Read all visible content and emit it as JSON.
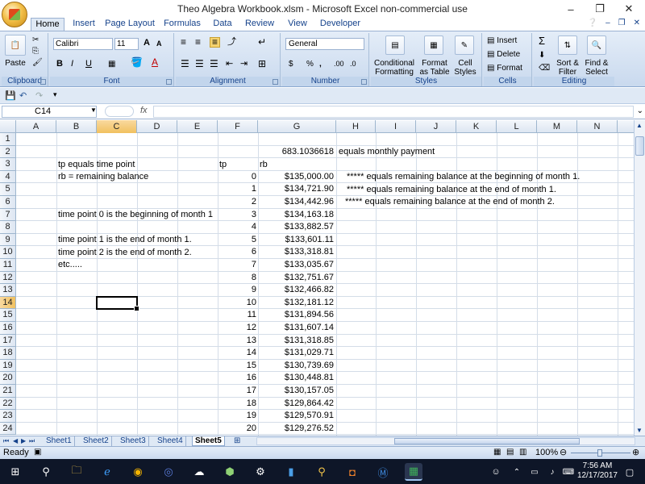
{
  "window": {
    "title": "Theo Algebra Workbook.xlsm - Microsoft Excel non-commercial use",
    "minimize": "–",
    "restore": "❐",
    "close": "✕"
  },
  "ribbon_tabs": [
    "Home",
    "Insert",
    "Page Layout",
    "Formulas",
    "Data",
    "Review",
    "View",
    "Developer"
  ],
  "active_tab": "Home",
  "ribbon": {
    "clipboard": {
      "label": "Clipboard",
      "paste": "Paste"
    },
    "font": {
      "label": "Font",
      "name": "Calibri",
      "size": "11",
      "bold": "B",
      "italic": "I",
      "underline": "U",
      "grow": "A",
      "shrink": "A"
    },
    "alignment": {
      "label": "Alignment"
    },
    "number": {
      "label": "Number",
      "format": "General",
      "currency": "$",
      "percent": "%",
      "comma": ",",
      "inc_dec": ".00",
      "dec_dec": ".0"
    },
    "styles": {
      "label": "Styles",
      "conditional": "Conditional",
      "conditional2": "Formatting",
      "format_table": "Format",
      "format_table2": "as Table",
      "cell_styles": "Cell",
      "cell_styles2": "Styles"
    },
    "cells": {
      "label": "Cells",
      "insert": "Insert",
      "delete": "Delete",
      "format": "Format"
    },
    "editing": {
      "label": "Editing",
      "sum": "Σ",
      "sort": "Sort &",
      "sort2": "Filter",
      "find": "Find &",
      "find2": "Select"
    }
  },
  "formula_bar": {
    "name_box": "C14",
    "fx": "fx",
    "content": ""
  },
  "columns": [
    "A",
    "B",
    "C",
    "D",
    "E",
    "F",
    "G",
    "H",
    "I",
    "J",
    "K",
    "L",
    "M",
    "N"
  ],
  "selected_column": "C",
  "rows": [
    "1",
    "2",
    "3",
    "4",
    "5",
    "6",
    "7",
    "8",
    "9",
    "10",
    "11",
    "12",
    "13",
    "14",
    "15",
    "16",
    "17",
    "18",
    "19",
    "20",
    "21",
    "22",
    "23",
    "24"
  ],
  "selected_row": "14",
  "cells": {
    "G2": "683.1036618",
    "H2": "equals monthly payment",
    "B3": "tp equals time point",
    "E3": "tp",
    "F3": "rb",
    "B4": "rb = remaining balance",
    "B7": "time point 0 is the beginning of month 1",
    "B9": "time point 1 is the end of month 1.",
    "B10": "time point 2 is the end of month 2.",
    "B11": "etc.....",
    "H4": "***** equals remaining balance at the beginning of month 1.",
    "H5": "***** equals remaining balance at the end of month 1.",
    "H6": "***** equals remaining balance at the end of month 2."
  },
  "tp_values": [
    "0",
    "1",
    "2",
    "3",
    "4",
    "5",
    "6",
    "7",
    "8",
    "9",
    "10",
    "11",
    "12",
    "13",
    "14",
    "15",
    "16",
    "17",
    "18",
    "19",
    "20"
  ],
  "rb_values": [
    "$135,000.00",
    "$134,721.90",
    "$134,442.96",
    "$134,163.18",
    "$133,882.57",
    "$133,601.11",
    "$133,318.81",
    "$133,035.67",
    "$132,751.67",
    "$132,466.82",
    "$132,181.12",
    "$131,894.56",
    "$131,607.14",
    "$131,318.85",
    "$131,029.71",
    "$130,739.69",
    "$130,448.81",
    "$130,157.05",
    "$129,864.42",
    "$129,570.91",
    "$129,276.52"
  ],
  "sheets": [
    "Sheet1",
    "Sheet2",
    "Sheet3",
    "Sheet4",
    "Sheet5"
  ],
  "active_sheet": "Sheet5",
  "status": {
    "mode": "Ready",
    "zoom": "100%"
  },
  "clock": {
    "time": "7:56 AM",
    "date": "12/17/2017"
  }
}
